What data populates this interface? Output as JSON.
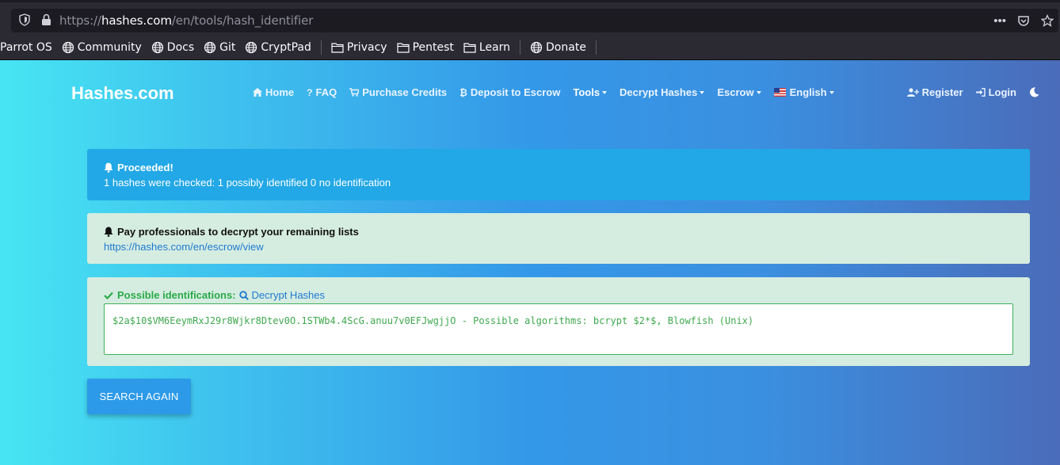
{
  "browser": {
    "url_prefix": "https://",
    "url_host": "hashes.com",
    "url_path": "/en/tools/hash_identifier",
    "url_menu_icon": "more-dots-icon",
    "pocket_icon": "pocket-icon",
    "bookmark_star_icon": "star-icon"
  },
  "bookmarks": [
    {
      "label": "Parrot OS",
      "icon": "none"
    },
    {
      "label": "Community",
      "icon": "globe-icon"
    },
    {
      "label": "Docs",
      "icon": "globe-icon"
    },
    {
      "label": "Git",
      "icon": "globe-icon"
    },
    {
      "label": "CryptPad",
      "icon": "globe-icon"
    },
    {
      "label": "Privacy",
      "icon": "folder-icon"
    },
    {
      "label": "Pentest",
      "icon": "folder-icon"
    },
    {
      "label": "Learn",
      "icon": "folder-icon"
    },
    {
      "label": "Donate",
      "icon": "globe-icon"
    }
  ],
  "site": {
    "brand": "Hashes.com",
    "nav": {
      "home": "Home",
      "faq": "FAQ",
      "purchase": "Purchase Credits",
      "deposit": "Deposit to Escrow",
      "tools": "Tools",
      "decrypt": "Decrypt Hashes",
      "escrow": "Escrow",
      "language": "English"
    },
    "nav_right": {
      "register": "Register",
      "login": "Login"
    }
  },
  "alerts": {
    "info_title": "Proceeded!",
    "info_text": "1 hashes were checked: 1 possibly identified 0 no identification",
    "pro_title": "Pay professionals to decrypt your remaining lists",
    "pro_link": "https://hashes.com/en/escrow/view",
    "possible_label": "Possible identifications:",
    "decrypt_link": "Decrypt Hashes",
    "result": "$2a$10$VM6EeymRxJ29r8Wjkr8Dtev0O.1STWb4.4ScG.anuu7v0EFJwgjjO - Possible algorithms: bcrypt $2*$, Blowfish (Unix)"
  },
  "search_again": "SEARCH AGAIN",
  "colors": {
    "info": "#22a8e6",
    "success_bg": "#d5ece0",
    "success_text": "#3fa84f",
    "link": "#1f7ad1",
    "button": "#2c9ae8"
  }
}
